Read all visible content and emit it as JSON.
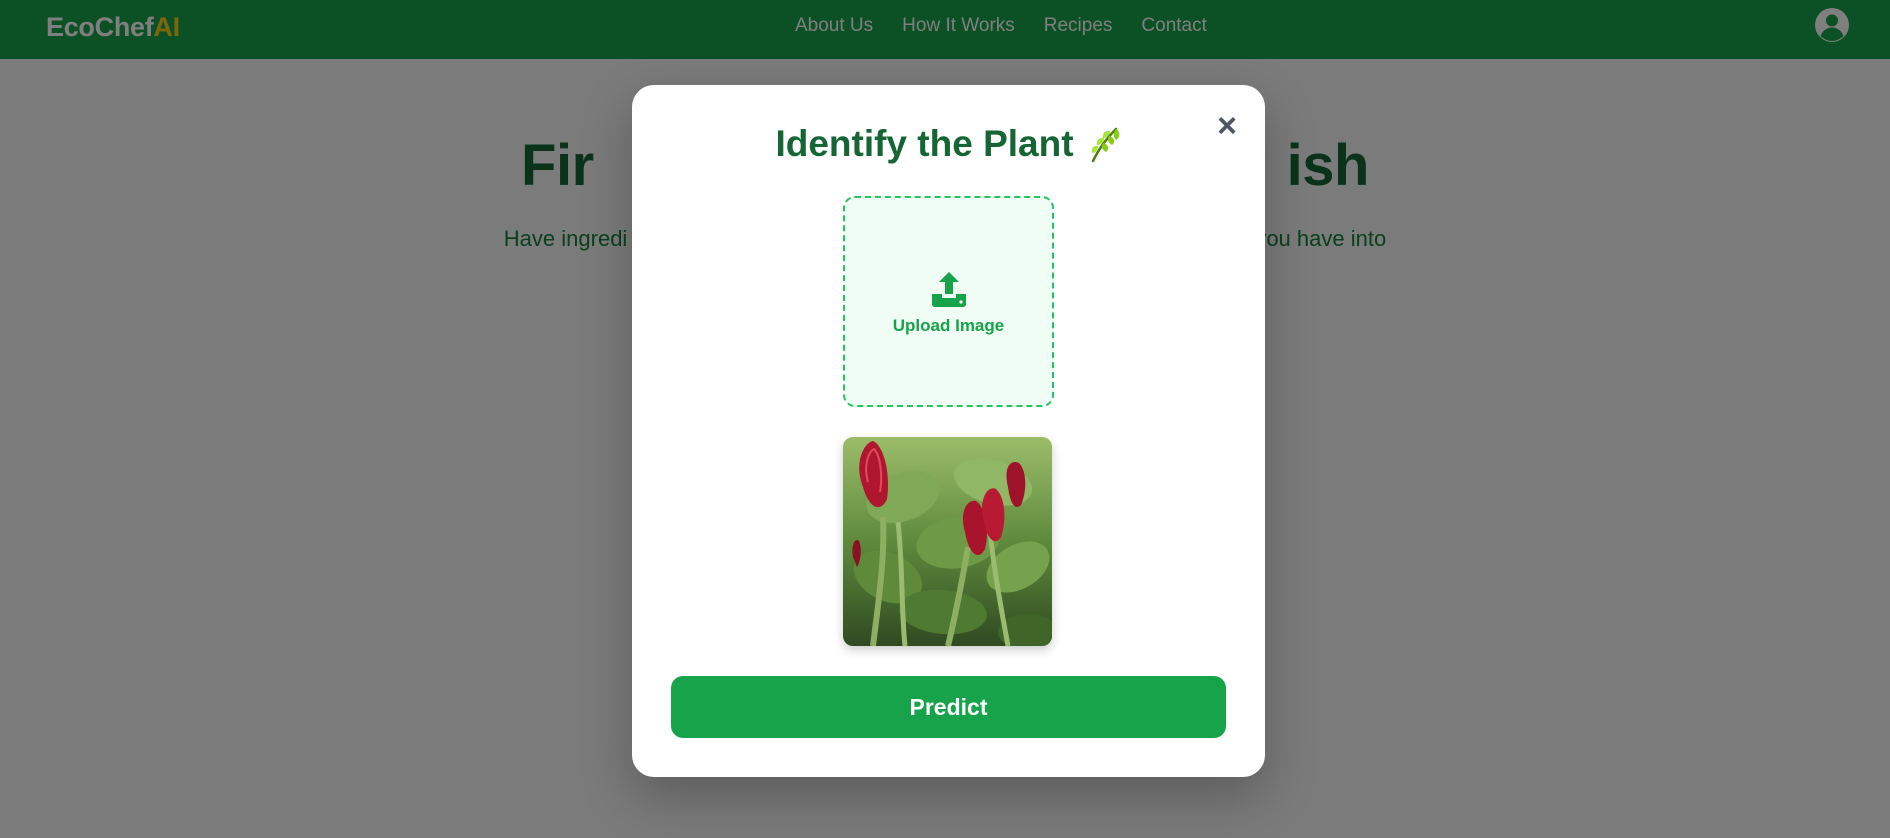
{
  "navbar": {
    "brand_part1": "EcoChef",
    "brand_part2": "AI",
    "links": [
      "About Us",
      "How It Works",
      "Recipes",
      "Contact"
    ],
    "avatar_icon": "user-circle-icon"
  },
  "hero": {
    "title_left": "Fir",
    "title_right": "ish",
    "subtitle_left": "Have ingredi",
    "subtitle_right": "you have into"
  },
  "modal": {
    "title": "Identify the Plant",
    "title_icon": "herb-leaf-icon",
    "close_icon": "close-icon",
    "close_label": "×",
    "upload": {
      "label": "Upload Image",
      "icon": "upload-icon"
    },
    "preview_alt": "Uploaded plant image preview",
    "predict_label": "Predict"
  },
  "colors": {
    "primary": "#16a34a",
    "dark_green": "#166534",
    "brand_accent": "#facc15",
    "overlay": "rgba(0,0,0,0.5)"
  }
}
